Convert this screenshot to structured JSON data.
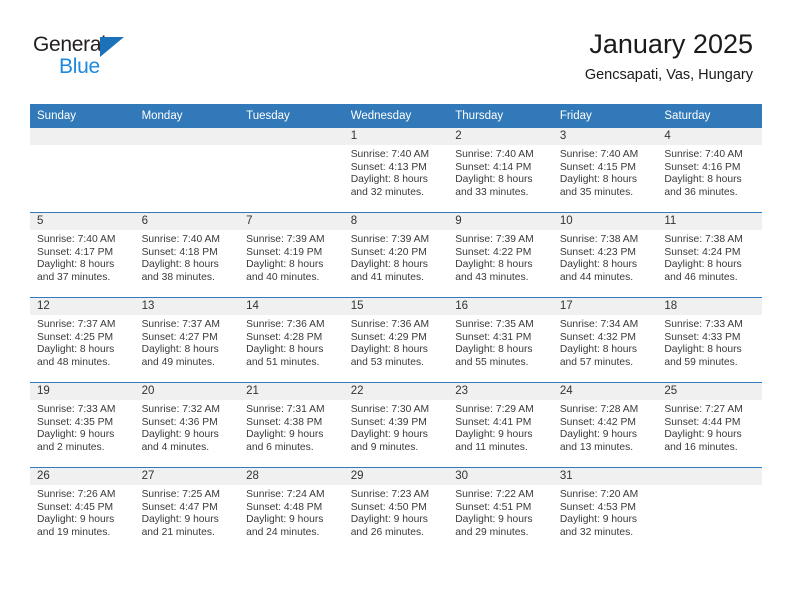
{
  "logo": {
    "text_top": "General",
    "text_bottom": "Blue",
    "color_top": "#231f20",
    "color_bottom": "#1b8ae0",
    "triangle_color": "#1b72b8"
  },
  "header": {
    "title": "January 2025",
    "subtitle": "Gencsapati, Vas, Hungary"
  },
  "theme": {
    "header_blue": "#3179b9",
    "daynum_band": "#f0f0f0",
    "text": "#3a3a3a"
  },
  "columns": [
    "Sunday",
    "Monday",
    "Tuesday",
    "Wednesday",
    "Thursday",
    "Friday",
    "Saturday"
  ],
  "weeks": [
    [
      {
        "day": "",
        "lines": []
      },
      {
        "day": "",
        "lines": []
      },
      {
        "day": "",
        "lines": []
      },
      {
        "day": "1",
        "lines": [
          "Sunrise: 7:40 AM",
          "Sunset: 4:13 PM",
          "Daylight: 8 hours",
          "and 32 minutes."
        ]
      },
      {
        "day": "2",
        "lines": [
          "Sunrise: 7:40 AM",
          "Sunset: 4:14 PM",
          "Daylight: 8 hours",
          "and 33 minutes."
        ]
      },
      {
        "day": "3",
        "lines": [
          "Sunrise: 7:40 AM",
          "Sunset: 4:15 PM",
          "Daylight: 8 hours",
          "and 35 minutes."
        ]
      },
      {
        "day": "4",
        "lines": [
          "Sunrise: 7:40 AM",
          "Sunset: 4:16 PM",
          "Daylight: 8 hours",
          "and 36 minutes."
        ]
      }
    ],
    [
      {
        "day": "5",
        "lines": [
          "Sunrise: 7:40 AM",
          "Sunset: 4:17 PM",
          "Daylight: 8 hours",
          "and 37 minutes."
        ]
      },
      {
        "day": "6",
        "lines": [
          "Sunrise: 7:40 AM",
          "Sunset: 4:18 PM",
          "Daylight: 8 hours",
          "and 38 minutes."
        ]
      },
      {
        "day": "7",
        "lines": [
          "Sunrise: 7:39 AM",
          "Sunset: 4:19 PM",
          "Daylight: 8 hours",
          "and 40 minutes."
        ]
      },
      {
        "day": "8",
        "lines": [
          "Sunrise: 7:39 AM",
          "Sunset: 4:20 PM",
          "Daylight: 8 hours",
          "and 41 minutes."
        ]
      },
      {
        "day": "9",
        "lines": [
          "Sunrise: 7:39 AM",
          "Sunset: 4:22 PM",
          "Daylight: 8 hours",
          "and 43 minutes."
        ]
      },
      {
        "day": "10",
        "lines": [
          "Sunrise: 7:38 AM",
          "Sunset: 4:23 PM",
          "Daylight: 8 hours",
          "and 44 minutes."
        ]
      },
      {
        "day": "11",
        "lines": [
          "Sunrise: 7:38 AM",
          "Sunset: 4:24 PM",
          "Daylight: 8 hours",
          "and 46 minutes."
        ]
      }
    ],
    [
      {
        "day": "12",
        "lines": [
          "Sunrise: 7:37 AM",
          "Sunset: 4:25 PM",
          "Daylight: 8 hours",
          "and 48 minutes."
        ]
      },
      {
        "day": "13",
        "lines": [
          "Sunrise: 7:37 AM",
          "Sunset: 4:27 PM",
          "Daylight: 8 hours",
          "and 49 minutes."
        ]
      },
      {
        "day": "14",
        "lines": [
          "Sunrise: 7:36 AM",
          "Sunset: 4:28 PM",
          "Daylight: 8 hours",
          "and 51 minutes."
        ]
      },
      {
        "day": "15",
        "lines": [
          "Sunrise: 7:36 AM",
          "Sunset: 4:29 PM",
          "Daylight: 8 hours",
          "and 53 minutes."
        ]
      },
      {
        "day": "16",
        "lines": [
          "Sunrise: 7:35 AM",
          "Sunset: 4:31 PM",
          "Daylight: 8 hours",
          "and 55 minutes."
        ]
      },
      {
        "day": "17",
        "lines": [
          "Sunrise: 7:34 AM",
          "Sunset: 4:32 PM",
          "Daylight: 8 hours",
          "and 57 minutes."
        ]
      },
      {
        "day": "18",
        "lines": [
          "Sunrise: 7:33 AM",
          "Sunset: 4:33 PM",
          "Daylight: 8 hours",
          "and 59 minutes."
        ]
      }
    ],
    [
      {
        "day": "19",
        "lines": [
          "Sunrise: 7:33 AM",
          "Sunset: 4:35 PM",
          "Daylight: 9 hours",
          "and 2 minutes."
        ]
      },
      {
        "day": "20",
        "lines": [
          "Sunrise: 7:32 AM",
          "Sunset: 4:36 PM",
          "Daylight: 9 hours",
          "and 4 minutes."
        ]
      },
      {
        "day": "21",
        "lines": [
          "Sunrise: 7:31 AM",
          "Sunset: 4:38 PM",
          "Daylight: 9 hours",
          "and 6 minutes."
        ]
      },
      {
        "day": "22",
        "lines": [
          "Sunrise: 7:30 AM",
          "Sunset: 4:39 PM",
          "Daylight: 9 hours",
          "and 9 minutes."
        ]
      },
      {
        "day": "23",
        "lines": [
          "Sunrise: 7:29 AM",
          "Sunset: 4:41 PM",
          "Daylight: 9 hours",
          "and 11 minutes."
        ]
      },
      {
        "day": "24",
        "lines": [
          "Sunrise: 7:28 AM",
          "Sunset: 4:42 PM",
          "Daylight: 9 hours",
          "and 13 minutes."
        ]
      },
      {
        "day": "25",
        "lines": [
          "Sunrise: 7:27 AM",
          "Sunset: 4:44 PM",
          "Daylight: 9 hours",
          "and 16 minutes."
        ]
      }
    ],
    [
      {
        "day": "26",
        "lines": [
          "Sunrise: 7:26 AM",
          "Sunset: 4:45 PM",
          "Daylight: 9 hours",
          "and 19 minutes."
        ]
      },
      {
        "day": "27",
        "lines": [
          "Sunrise: 7:25 AM",
          "Sunset: 4:47 PM",
          "Daylight: 9 hours",
          "and 21 minutes."
        ]
      },
      {
        "day": "28",
        "lines": [
          "Sunrise: 7:24 AM",
          "Sunset: 4:48 PM",
          "Daylight: 9 hours",
          "and 24 minutes."
        ]
      },
      {
        "day": "29",
        "lines": [
          "Sunrise: 7:23 AM",
          "Sunset: 4:50 PM",
          "Daylight: 9 hours",
          "and 26 minutes."
        ]
      },
      {
        "day": "30",
        "lines": [
          "Sunrise: 7:22 AM",
          "Sunset: 4:51 PM",
          "Daylight: 9 hours",
          "and 29 minutes."
        ]
      },
      {
        "day": "31",
        "lines": [
          "Sunrise: 7:20 AM",
          "Sunset: 4:53 PM",
          "Daylight: 9 hours",
          "and 32 minutes."
        ]
      },
      {
        "day": "",
        "lines": []
      }
    ]
  ]
}
